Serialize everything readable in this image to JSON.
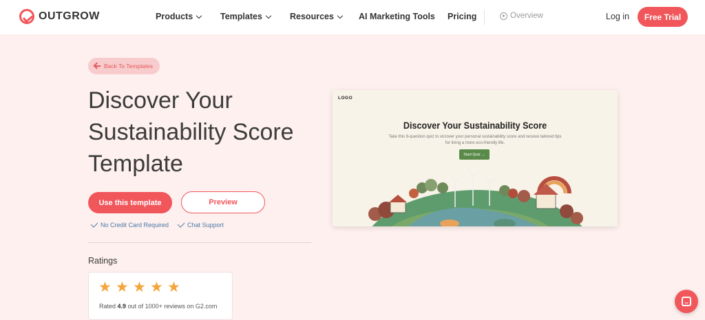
{
  "brand": {
    "name": "OUTGROW",
    "accent": "#f1565b",
    "background": "#fdf0ee"
  },
  "nav": {
    "items": [
      {
        "label": "Products",
        "dropdown": true
      },
      {
        "label": "Templates",
        "dropdown": true
      },
      {
        "label": "Resources",
        "dropdown": true
      },
      {
        "label": "AI Marketing Tools",
        "dropdown": false
      },
      {
        "label": "Pricing",
        "dropdown": false
      }
    ],
    "overview": "Overview",
    "login": "Log in",
    "trial": "Free Trial"
  },
  "hero": {
    "back": "Back To Templates",
    "title": "Discover Your Sustainability Score Template",
    "primary_cta": "Use this template",
    "secondary_cta": "Preview",
    "features": [
      "No Credit Card Required",
      "Chat Support"
    ]
  },
  "ratings": {
    "label": "Ratings",
    "stars": 5,
    "text_prefix": "Rated",
    "score": "4.9",
    "text_suffix": "out of 1000+ reviews on G2.com"
  },
  "preview": {
    "logo": "LOGO",
    "title": "Discover Your Sustainability Score",
    "subtitle": "Take this 8-question quiz to uncover your personal sustainability score and receive tailored tips for living a more eco-friendly life.",
    "button": "Start Quiz →"
  },
  "icons": [
    "outgrow-logo-icon",
    "chevron-down-icon",
    "play-circle-icon",
    "arrow-left-icon",
    "check-icon",
    "star-icon",
    "chat-icon"
  ]
}
